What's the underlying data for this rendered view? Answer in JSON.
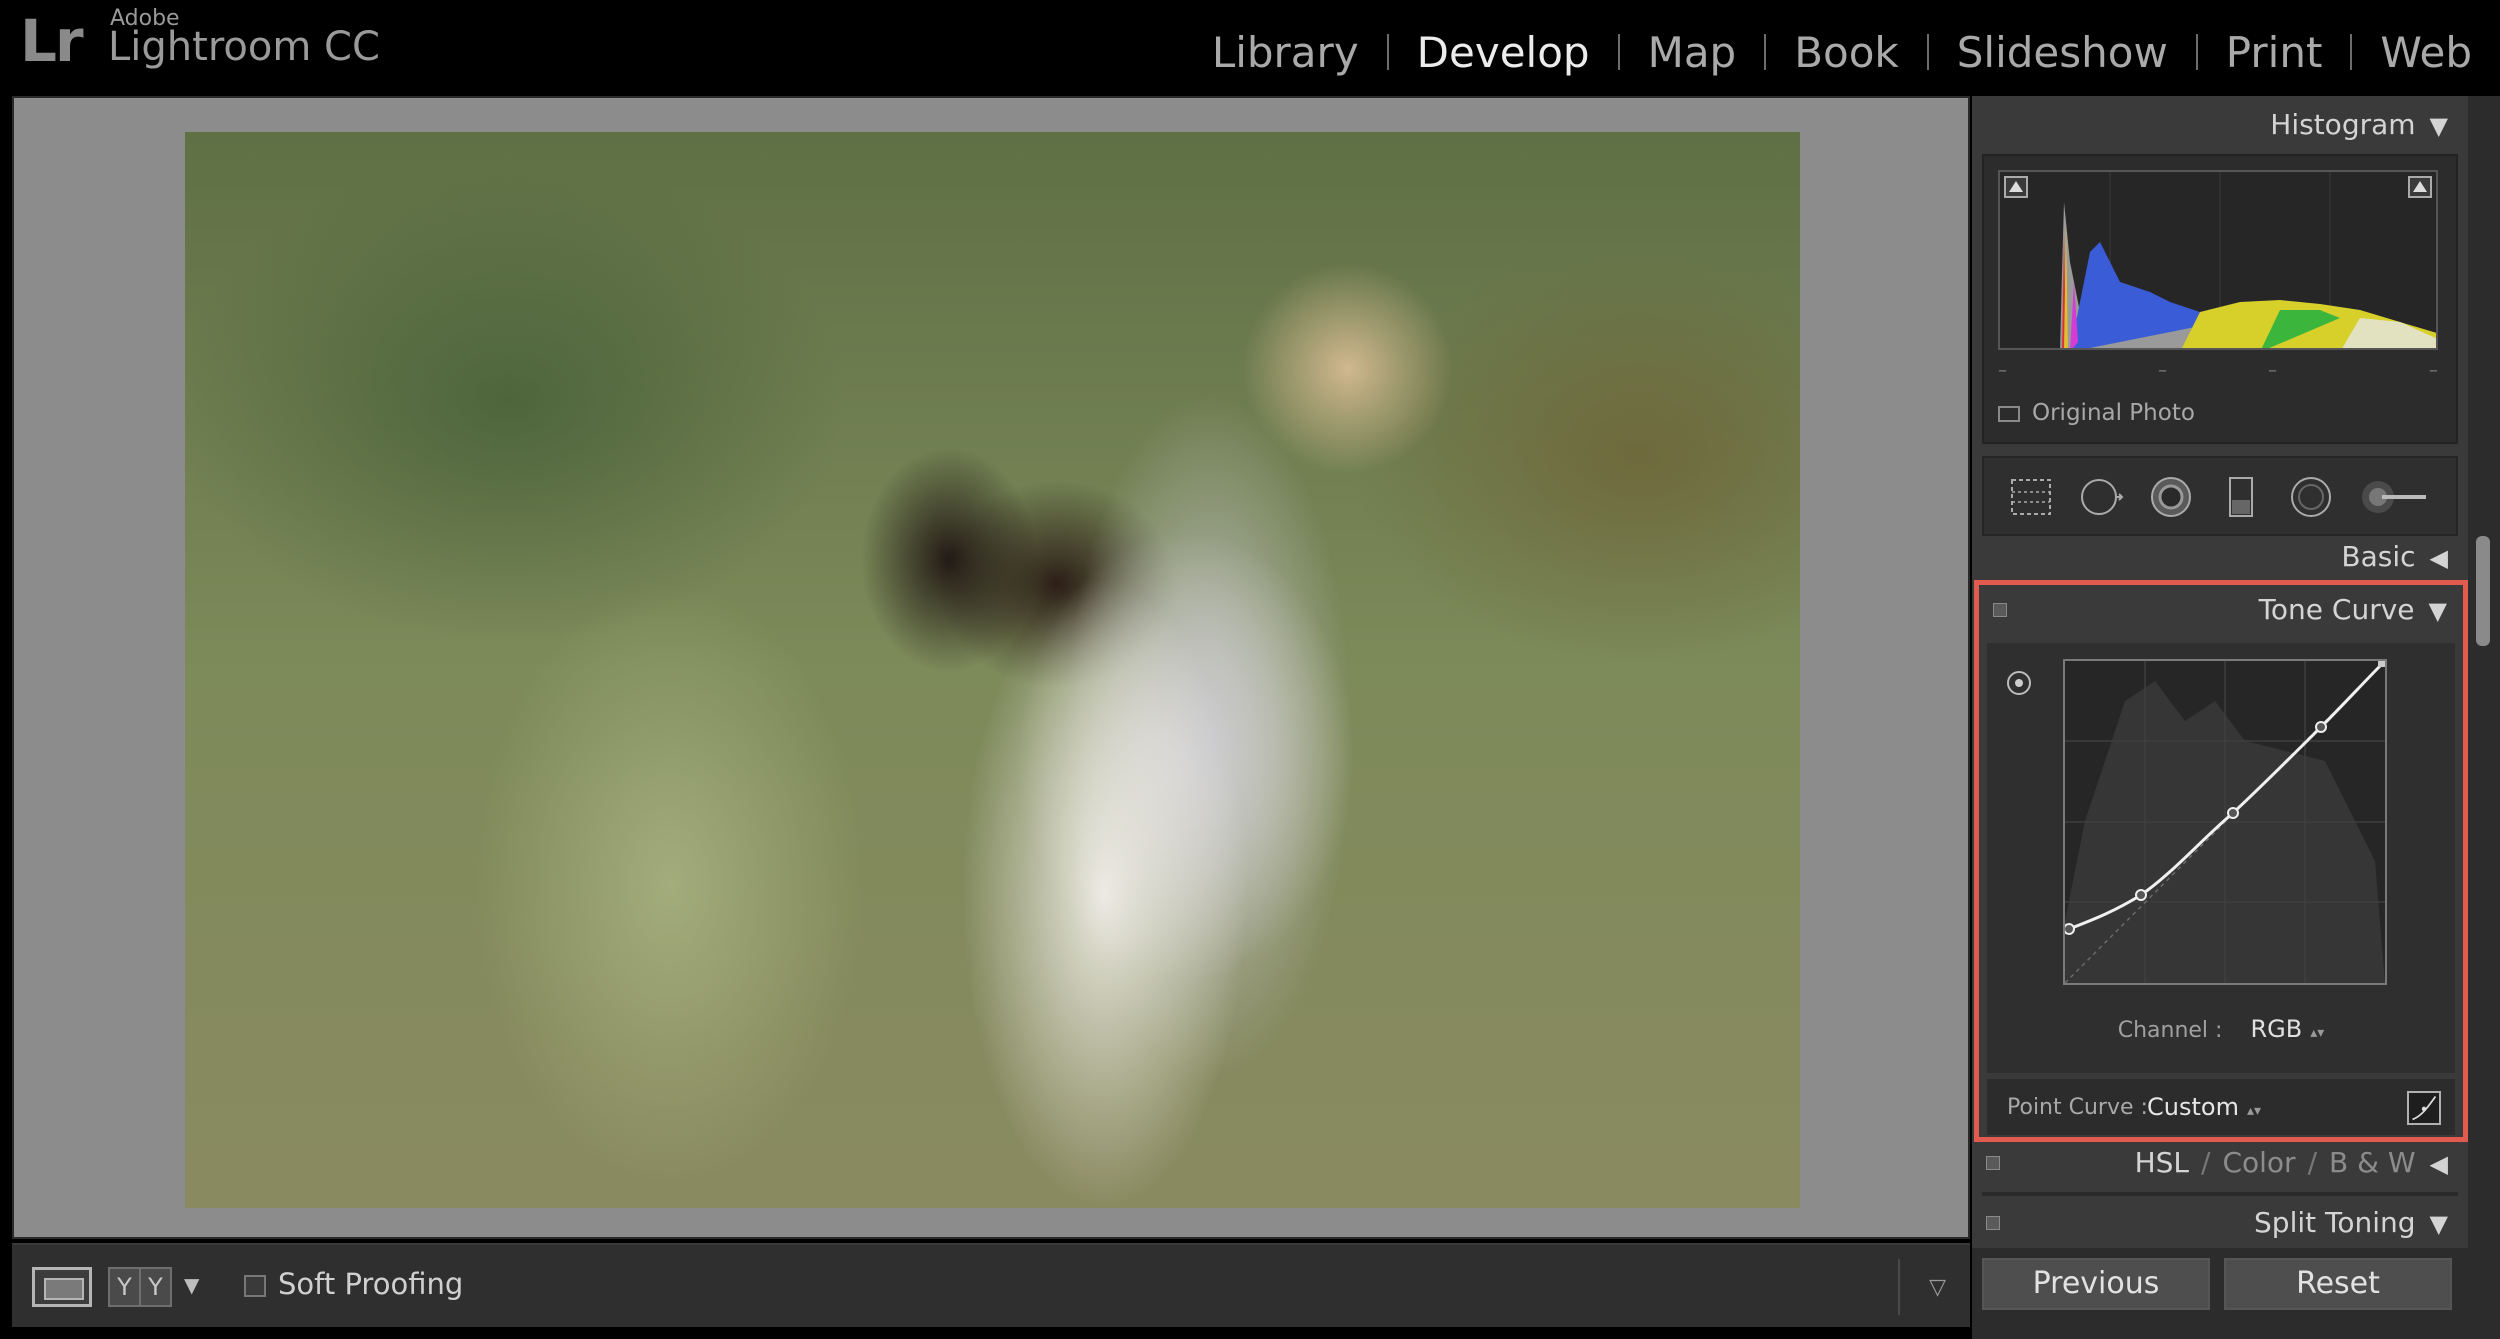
{
  "app": {
    "brand_mark": "Lr",
    "company": "Adobe",
    "product": "Lightroom CC"
  },
  "modules": [
    {
      "label": "Library",
      "active": false
    },
    {
      "label": "Develop",
      "active": true
    },
    {
      "label": "Map",
      "active": false
    },
    {
      "label": "Book",
      "active": false
    },
    {
      "label": "Slideshow",
      "active": false
    },
    {
      "label": "Print",
      "active": false
    },
    {
      "label": "Web",
      "active": false
    }
  ],
  "toolbar": {
    "compare_left": "Y",
    "compare_right": "Y",
    "soft_proofing_label": "Soft Proofing",
    "soft_proofing_checked": false
  },
  "histogram": {
    "title": "Histogram",
    "info": [
      "–",
      "–",
      "–",
      "–"
    ],
    "original_photo_label": "Original Photo"
  },
  "tools": [
    "crop-overlay",
    "spot-removal",
    "red-eye",
    "graduated-filter",
    "radial-filter",
    "adjustment-brush"
  ],
  "panels": {
    "basic": "Basic",
    "tone_curve": "Tone Curve",
    "channel_label": "Channel :",
    "channel_value": "RGB",
    "point_curve_label": "Point Curve :",
    "point_curve_value": "Custom",
    "hsl": "HSL",
    "color": "Color",
    "bw": "B & W",
    "split_toning": "Split Toning"
  },
  "buttons": {
    "previous": "Previous",
    "reset": "Reset"
  },
  "colors": {
    "highlight": "#e25b4f",
    "panel_bg": "#3a3a3a",
    "canvas_bg": "#8c8c8c"
  }
}
